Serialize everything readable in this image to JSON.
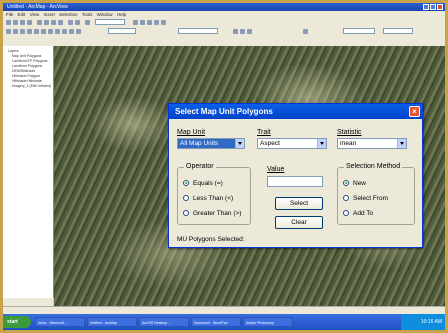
{
  "window": {
    "title": "Untitled - ArcMap - ArcView"
  },
  "menubar": {
    "items": [
      "File",
      "Edit",
      "View",
      "Insert",
      "Selection",
      "Tools",
      "Window",
      "Help"
    ]
  },
  "toc": {
    "items": [
      "Layers",
      "Map Unit Polygons",
      "Landform/TP Polygons",
      "Landform Polygons",
      "DEM/Hillshade",
      "Hillshade Polygon",
      "Hillshade Hillshade",
      "Imagery_1 (MW Infrared)"
    ]
  },
  "taskbar": {
    "start_label": "start",
    "tasks": [
      "Inbox - Microsoft...",
      "Untitled - ArcMap",
      "ArcGIS Desktop...",
      "Document - WordPad",
      "Adobe Photoshop"
    ],
    "clock": "10:16 AM"
  },
  "dialog": {
    "title": "Select Map Unit Polygons",
    "map_unit": {
      "label": "Map Unit",
      "value": "All Map Units"
    },
    "trait": {
      "label": "Trait",
      "value": "Aspect"
    },
    "statistic": {
      "label": "Statistic",
      "value": "mean"
    },
    "operator": {
      "label": "Operator",
      "options": [
        {
          "label": "Equals (=)",
          "selected": true
        },
        {
          "label": "Less Than (<)",
          "selected": false
        },
        {
          "label": "Greater Than (>)",
          "selected": false
        }
      ]
    },
    "value": {
      "label": "Value",
      "current": ""
    },
    "select_label": "Select",
    "clear_label": "Clear",
    "selection_method": {
      "label": "Selection Method",
      "options": [
        {
          "label": "New",
          "selected": true
        },
        {
          "label": "Select From",
          "selected": false
        },
        {
          "label": "Add To",
          "selected": false
        }
      ]
    },
    "status": "MU Polygons Selected:"
  }
}
